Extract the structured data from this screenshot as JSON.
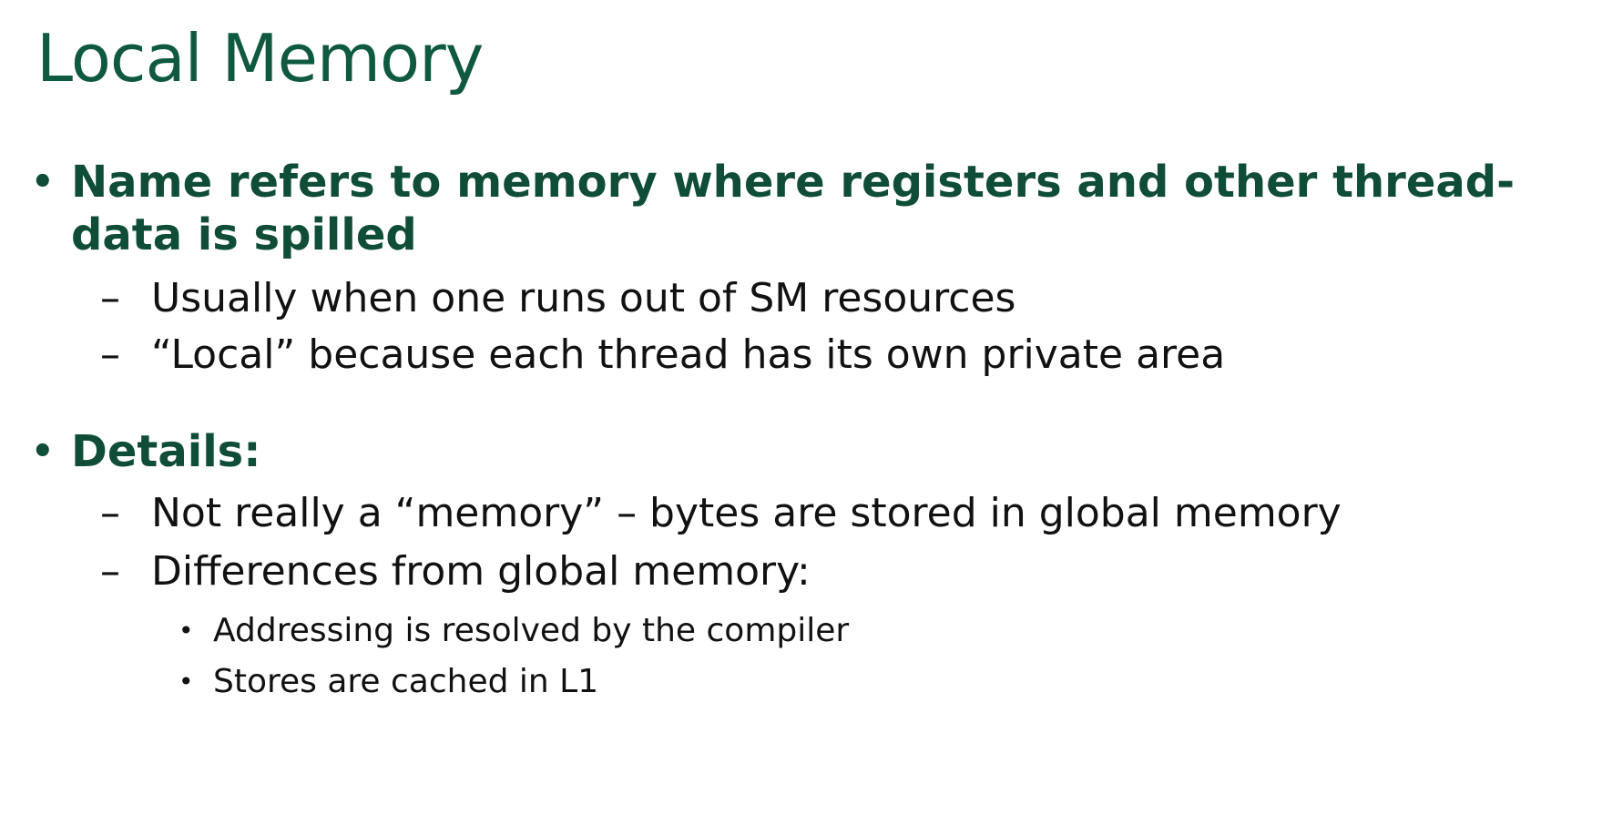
{
  "slide": {
    "title": "Local Memory",
    "bullets": [
      {
        "marker": "•",
        "lines": [
          "Name refers to memory where registers and other thread-",
          "data is spilled"
        ],
        "subitems": [
          {
            "marker": "–",
            "text": "Usually when one runs out of SM resources"
          },
          {
            "marker": "–",
            "text": "“Local” because each thread has its own private area"
          }
        ]
      },
      {
        "marker": "•",
        "lines": [
          "Details:"
        ],
        "subitems": [
          {
            "marker": "–",
            "text": "Not really a “memory” – bytes are stored in global memory"
          },
          {
            "marker": "–",
            "text": "Differences from global memory:",
            "subitems": [
              {
                "marker": "•",
                "text": "Addressing is resolved by the compiler"
              },
              {
                "marker": "•",
                "text": "Stores are cached in L1"
              }
            ]
          }
        ]
      }
    ]
  }
}
